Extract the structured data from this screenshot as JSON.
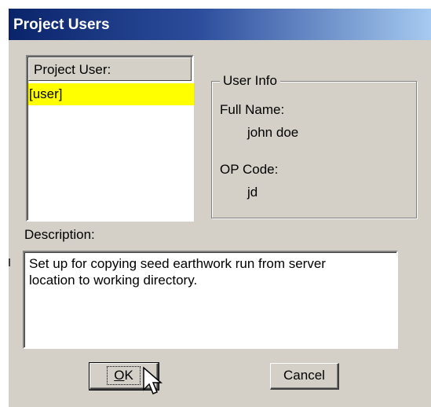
{
  "window": {
    "title": "Project Users"
  },
  "project_users": {
    "header": "Project User:",
    "items": [
      "[user]"
    ],
    "selected_index": 0
  },
  "user_info": {
    "legend": "User Info",
    "full_name_label": "Full Name:",
    "full_name_value": "john doe",
    "op_code_label": "OP Code:",
    "op_code_value": "jd"
  },
  "description": {
    "label": "Description:",
    "text_line1": "Set up for copying seed earthwork run from server",
    "text_line2": "location to working directory."
  },
  "buttons": {
    "ok_prefix": "",
    "ok_mnemonic": "O",
    "ok_rest": "K",
    "cancel": "Cancel"
  },
  "colors": {
    "title_bar": "#0a246a",
    "selection": "#ffff00",
    "dialog_bg": "#d4d0c8"
  },
  "icons": {
    "cursor": "arrow-cursor-icon"
  }
}
